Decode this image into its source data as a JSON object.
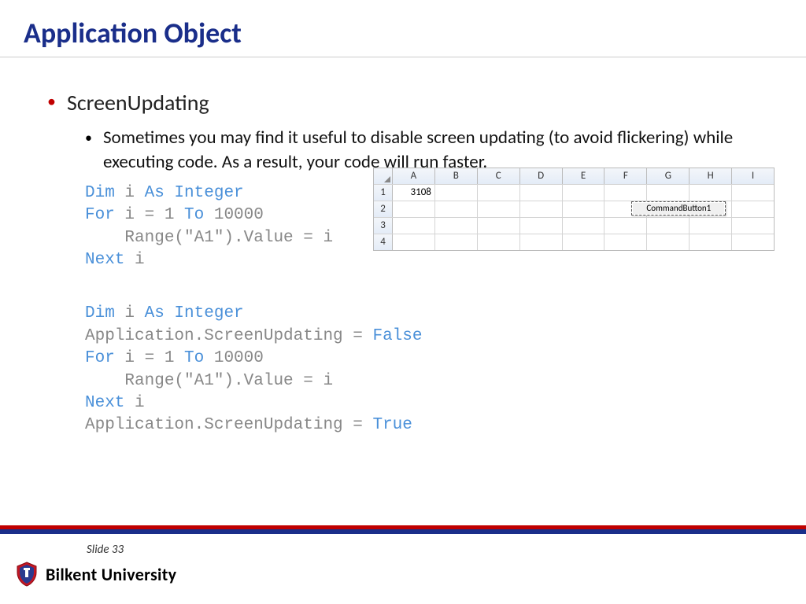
{
  "title": "Application Object",
  "bullets": {
    "l1": "ScreenUpdating",
    "l2": "Sometimes you may find it useful to disable screen updating (to avoid flickering) while executing code. As a result, your code will run faster."
  },
  "code1": {
    "dim": "Dim",
    "var1": " i ",
    "as": "As Integer",
    "for": "For",
    "forrest": " i = 1 ",
    "to": "To",
    "torest": " 10000",
    "body": "    Range(\"A1\").Value = i",
    "next": "Next",
    "nextrest": " i"
  },
  "code2": {
    "dim": "Dim",
    "var1": " i ",
    "as": "As Integer",
    "line2a": "Application.ScreenUpdating = ",
    "false": "False",
    "for": "For",
    "forrest": " i = 1 ",
    "to": "To",
    "torest": " 10000",
    "body": "    Range(\"A1\").Value = i",
    "next": "Next",
    "nextrest": " i",
    "line6a": "Application.ScreenUpdating = ",
    "true": "True"
  },
  "spreadsheet": {
    "cols": [
      "A",
      "B",
      "C",
      "D",
      "E",
      "F",
      "G",
      "H",
      "I"
    ],
    "rows": [
      "1",
      "2",
      "3",
      "4"
    ],
    "a1": "3108",
    "button": "CommandButton1"
  },
  "footer": {
    "slide": "Slide 33",
    "university": "Bilkent University"
  }
}
